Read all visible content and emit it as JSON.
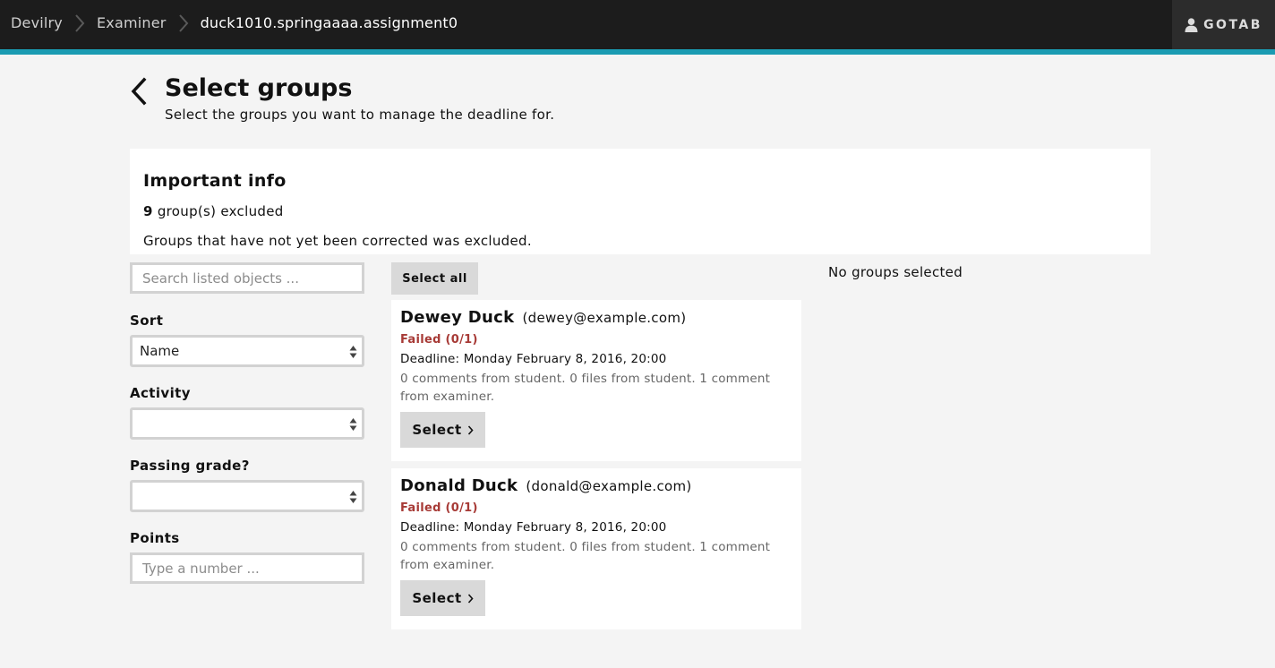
{
  "breadcrumb": {
    "items": [
      "Devilry",
      "Examiner",
      "duck1010.springaaaa.assignment0"
    ]
  },
  "user_menu": {
    "label": "GOTAB",
    "icon": "user-icon"
  },
  "header": {
    "title": "Select groups",
    "subtitle": "Select the groups you want to manage the deadline for.",
    "back_icon": "chevron-left-icon"
  },
  "info": {
    "title": "Important info",
    "excluded_count": "9",
    "excluded_text": "group(s) excluded",
    "excluded_reason": "Groups that have not yet been corrected was excluded."
  },
  "filters": {
    "search": {
      "placeholder": "Search listed objects ...",
      "value": ""
    },
    "sort": {
      "label": "Sort",
      "value": "Name"
    },
    "activity": {
      "label": "Activity",
      "value": ""
    },
    "passing_grade": {
      "label": "Passing grade?",
      "value": ""
    },
    "points": {
      "label": "Points",
      "placeholder": "Type a number ...",
      "value": ""
    }
  },
  "list": {
    "select_all_label": "Select all",
    "groups": [
      {
        "name": "Dewey Duck",
        "email": "(dewey@example.com)",
        "status": "Failed (0/1)",
        "deadline": "Deadline: Monday February 8, 2016, 20:00",
        "summary": "0 comments from student. 0 files from student. 1 comment from examiner.",
        "select_label": "Select"
      },
      {
        "name": "Donald Duck",
        "email": "(donald@example.com)",
        "status": "Failed (0/1)",
        "deadline": "Deadline: Monday February 8, 2016, 20:00",
        "summary": "0 comments from student. 0 files from student. 1 comment from examiner.",
        "select_label": "Select"
      }
    ]
  },
  "selection": {
    "empty_text": "No groups selected"
  },
  "colors": {
    "nav_background": "#1c1c1c",
    "nav_accent": "#1a9bb2",
    "page_background": "#f4f4f4",
    "status_failed": "#a73a36",
    "button_background": "#d9d9d9"
  }
}
